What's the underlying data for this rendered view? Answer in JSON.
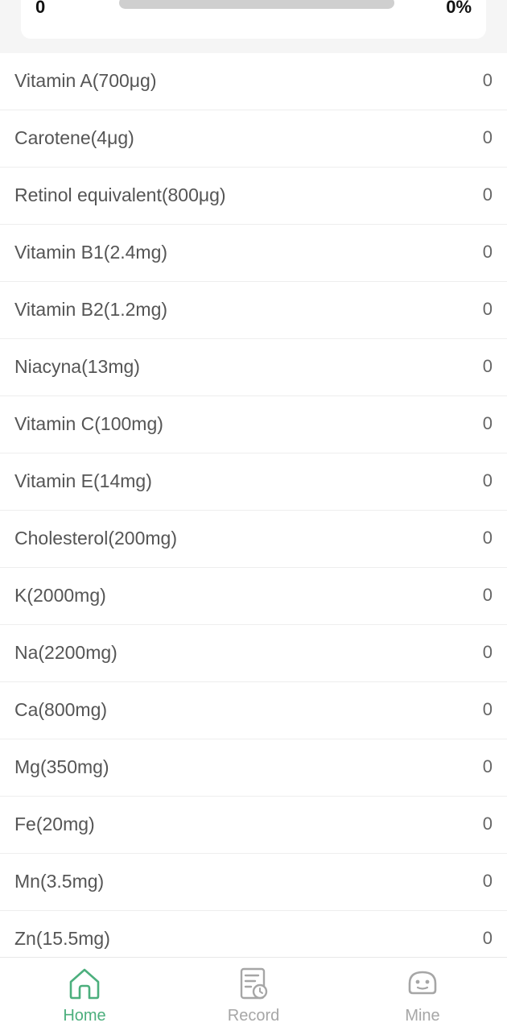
{
  "summary": {
    "left_value": "0",
    "percent_label": "0%",
    "progress_fraction": 0
  },
  "nutrients": [
    {
      "label": "Vitamin A(700μg)",
      "value": "0"
    },
    {
      "label": "Carotene(4μg)",
      "value": "0"
    },
    {
      "label": "Retinol equivalent(800μg)",
      "value": "0"
    },
    {
      "label": "Vitamin B1(2.4mg)",
      "value": "0"
    },
    {
      "label": "Vitamin B2(1.2mg)",
      "value": "0"
    },
    {
      "label": "Niacyna(13mg)",
      "value": "0"
    },
    {
      "label": "Vitamin C(100mg)",
      "value": "0"
    },
    {
      "label": "Vitamin E(14mg)",
      "value": "0"
    },
    {
      "label": "Cholesterol(200mg)",
      "value": "0"
    },
    {
      "label": "K(2000mg)",
      "value": "0"
    },
    {
      "label": "Na(2200mg)",
      "value": "0"
    },
    {
      "label": "Ca(800mg)",
      "value": "0"
    },
    {
      "label": "Mg(350mg)",
      "value": "0"
    },
    {
      "label": "Fe(20mg)",
      "value": "0"
    },
    {
      "label": "Mn(3.5mg)",
      "value": "0"
    },
    {
      "label": "Zn(15.5mg)",
      "value": "0"
    }
  ],
  "tabbar": {
    "tabs": [
      {
        "label": "Home",
        "icon": "home-icon",
        "active": true
      },
      {
        "label": "Record",
        "icon": "record-icon",
        "active": false
      },
      {
        "label": "Mine",
        "icon": "mine-icon",
        "active": false
      }
    ]
  },
  "colors": {
    "accent": "#4caf7d",
    "inactive": "#a6a6a6",
    "track": "#cfcfcf"
  }
}
